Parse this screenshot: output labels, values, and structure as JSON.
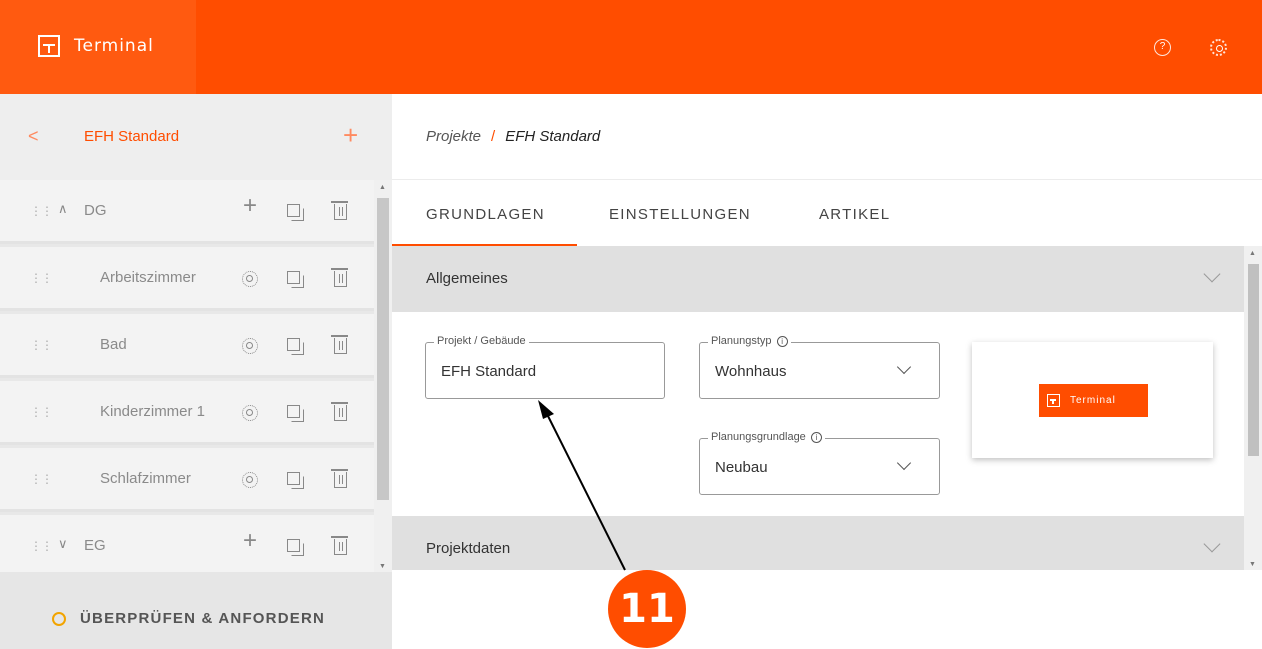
{
  "app": {
    "name": "Terminal",
    "help_icon": "help-circle-icon",
    "settings_icon": "gear-icon"
  },
  "sidebar": {
    "title": "EFH Standard",
    "back_icon": "chevron-left-icon",
    "add_icon": "plus-icon",
    "rows": [
      {
        "label": "DG",
        "type": "group",
        "expanded": true
      },
      {
        "label": "Arbeitszimmer",
        "type": "room"
      },
      {
        "label": "Bad",
        "type": "room"
      },
      {
        "label": "Kinderzimmer 1",
        "type": "room"
      },
      {
        "label": "Schlafzimmer",
        "type": "room"
      },
      {
        "label": "EG",
        "type": "group",
        "expanded": false
      }
    ],
    "review_label": "ÜBERPRÜFEN & ANFORDERN"
  },
  "breadcrumb": {
    "root": "Projekte",
    "separator": "/",
    "current": "EFH Standard"
  },
  "tabs": [
    {
      "label": "GRUNDLAGEN",
      "active": true
    },
    {
      "label": "EINSTELLUNGEN",
      "active": false
    },
    {
      "label": "ARTIKEL",
      "active": false
    }
  ],
  "sections": {
    "general": {
      "title": "Allgemeines"
    },
    "project_data": {
      "title": "Projektdaten"
    }
  },
  "form": {
    "project": {
      "label": "Projekt / Gebäude",
      "value": "EFH Standard"
    },
    "planning_type": {
      "label": "Planungstyp",
      "value": "Wohnhaus"
    },
    "planning_basis": {
      "label": "Planungsgrundlage",
      "value": "Neubau"
    }
  },
  "preview": {
    "logo_text": "Terminal"
  },
  "annotation": {
    "badge": "11"
  },
  "colors": {
    "accent": "#ff4d00",
    "review_ring": "#f2a400"
  }
}
